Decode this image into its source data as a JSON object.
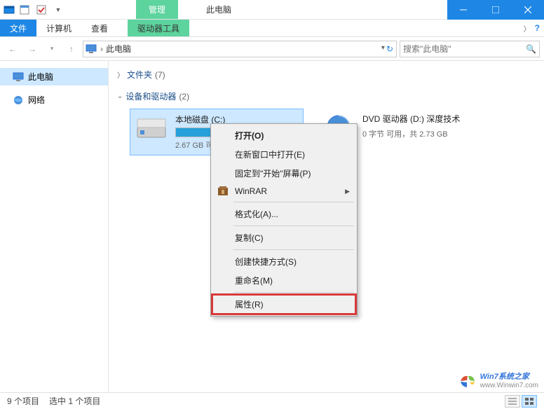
{
  "titlebar": {
    "contextual_tab": "管理",
    "title": "此电脑"
  },
  "ribbon": {
    "file": "文件",
    "computer": "计算机",
    "view": "查看",
    "drive_tools": "驱动器工具"
  },
  "nav": {
    "breadcrumb_root": "此电脑",
    "search_placeholder": "搜索\"此电脑\""
  },
  "sidebar": {
    "this_pc": "此电脑",
    "network": "网络"
  },
  "groups": {
    "folders": {
      "label": "文件夹",
      "count": "(7)"
    },
    "devices": {
      "label": "设备和驱动器",
      "count": "(2)"
    }
  },
  "drives": {
    "c": {
      "name": "本地磁盘 (C:)",
      "fill_percent": 93,
      "stats": "2.67 GB 可用"
    },
    "d": {
      "name": "DVD 驱动器 (D:) 深度技术",
      "stats": "0 字节 可用，共 2.73 GB"
    }
  },
  "context_menu": {
    "open": "打开(O)",
    "open_new_window": "在新窗口中打开(E)",
    "pin_start": "固定到\"开始\"屏幕(P)",
    "winrar": "WinRAR",
    "format": "格式化(A)...",
    "copy": "复制(C)",
    "create_shortcut": "创建快捷方式(S)",
    "rename": "重命名(M)",
    "properties": "属性(R)"
  },
  "statusbar": {
    "items": "9 个项目",
    "selected": "选中 1 个项目"
  },
  "watermark": {
    "line1": "Win7系统之家",
    "line2": "www.Winwin7.com"
  }
}
